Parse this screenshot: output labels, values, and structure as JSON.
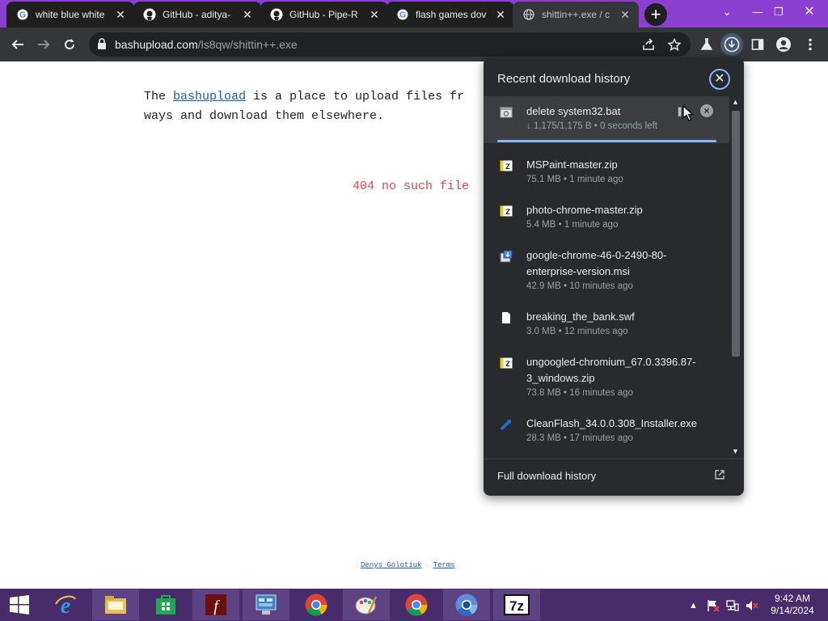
{
  "tabs": [
    {
      "title": "white blue white",
      "icon": "google-icon"
    },
    {
      "title": "GitHub - aditya-",
      "icon": "github-icon"
    },
    {
      "title": "GitHub - Pipe-R",
      "icon": "github-icon"
    },
    {
      "title": "flash games dov",
      "icon": "google-icon"
    },
    {
      "title": "shittin++.exe / c",
      "icon": "globe-icon",
      "active": true
    }
  ],
  "toolbar": {
    "url_host": "bashupload.com",
    "url_path": "/ls8qw/shittin++.exe"
  },
  "page": {
    "intro_before": "The ",
    "intro_link": "bashupload",
    "intro_after": " is a place to upload files fr",
    "intro_line2": "ways and download them elsewhere.",
    "error": "404 no such file",
    "footer_links": [
      "Denys Golotiuk",
      "Terms"
    ]
  },
  "downloads": {
    "header": "Recent download history",
    "full_history": "Full download history",
    "items": [
      {
        "name": "delete system32.bat",
        "meta": "↓ 1,175/1,175 B • 0 seconds left",
        "icon": "batch-file-icon",
        "in_progress": true
      },
      {
        "name": "MSPaint-master.zip",
        "meta": "75.1 MB • 1 minute ago",
        "icon": "7zip-archive-icon"
      },
      {
        "name": "photo-chrome-master.zip",
        "meta": "5.4 MB • 1 minute ago",
        "icon": "7zip-archive-icon"
      },
      {
        "name": "google-chrome-46-0-2490-80-enterprise-version.msi",
        "meta": "42.9 MB • 10 minutes ago",
        "icon": "installer-icon"
      },
      {
        "name": "breaking_the_bank.swf",
        "meta": "3.0 MB • 12 minutes ago",
        "icon": "file-icon"
      },
      {
        "name": "ungoogled-chromium_67.0.3396.87-3_windows.zip",
        "meta": "73.8 MB • 16 minutes ago",
        "icon": "7zip-archive-icon"
      },
      {
        "name": "CleanFlash_34.0.0.308_Installer.exe",
        "meta": "28.3 MB • 17 minutes ago",
        "icon": "flash-installer-icon"
      }
    ]
  },
  "taskbar": {
    "time": "9:42 AM",
    "date": "9/14/2024"
  }
}
